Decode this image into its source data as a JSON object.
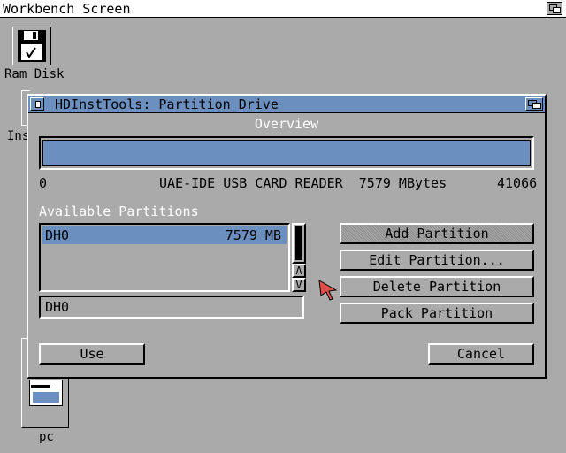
{
  "workbench": {
    "title": "Workbench Screen"
  },
  "desktop_icons": {
    "ram_disk": {
      "label": "Ram Disk"
    },
    "inst_partial": {
      "label": "Ins"
    },
    "pc": {
      "label": "pc"
    }
  },
  "window": {
    "title": "HDInstTools: Partition Drive",
    "overview_label": "Overview",
    "drive_info": {
      "start": "0",
      "description": "UAE-IDE USB CARD READER  7579 MBytes",
      "end": "41066"
    },
    "partitions_label": "Available Partitions",
    "partitions": [
      {
        "name": "DH0",
        "size": "7579 MB"
      }
    ],
    "selected_partition": "DH0",
    "buttons": {
      "add": "Add Partition",
      "edit": "Edit Partition...",
      "delete": "Delete Partition",
      "pack": "Pack Partition",
      "use": "Use",
      "cancel": "Cancel"
    }
  },
  "colors": {
    "background": "#aaaaaa",
    "title_bar": "#6b8fbf",
    "selection": "#6b8fbf",
    "pointer": "#e0504a"
  }
}
